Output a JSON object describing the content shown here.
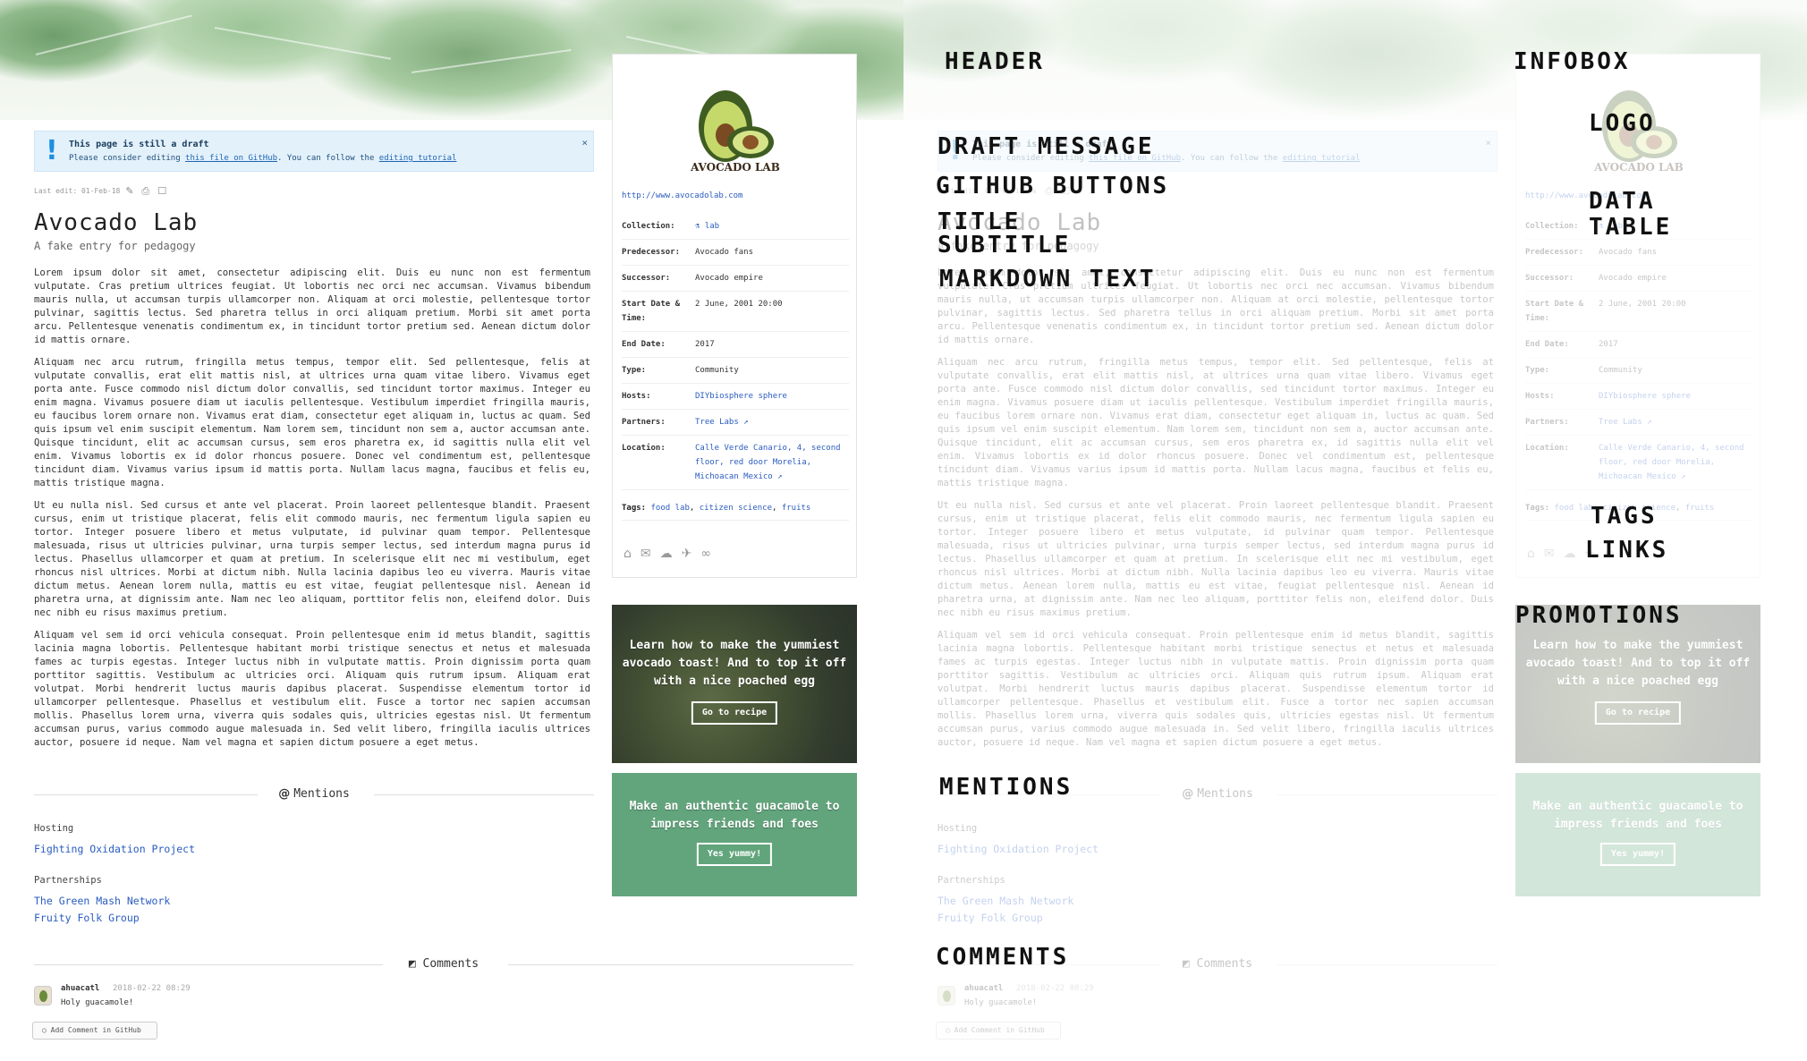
{
  "draft": {
    "title": "This page is still a draft",
    "msg_pre": "Please consider editing ",
    "msg_link1": "this file on GitHub",
    "msg_mid": ". You can follow the ",
    "msg_link2": "editing tutorial",
    "close": "×"
  },
  "lastedit": "Last edit: 01-Feb-18",
  "page": {
    "title": "Avocado Lab",
    "subtitle": "A fake entry for pedagogy"
  },
  "body_paragraphs": [
    "Lorem ipsum dolor sit amet, consectetur adipiscing elit. Duis eu nunc non est fermentum vulputate. Cras pretium ultrices feugiat. Ut lobortis nec orci nec accumsan. Vivamus bibendum mauris nulla, ut accumsan turpis ullamcorper non. Aliquam at orci molestie, pellentesque tortor pulvinar, sagittis lectus. Sed pharetra tellus in orci aliquam pretium. Morbi sit amet porta arcu. Pellentesque venenatis condimentum ex, in tincidunt tortor pretium sed. Aenean dictum dolor id mattis ornare.",
    "Aliquam nec arcu rutrum, fringilla metus tempus, tempor elit. Sed pellentesque, felis at vulputate convallis, erat elit mattis nisl, at ultrices urna quam vitae libero. Vivamus eget porta ante. Fusce commodo nisl dictum dolor convallis, sed tincidunt tortor maximus. Integer eu enim magna. Vivamus posuere diam ut iaculis pellentesque. Vestibulum imperdiet fringilla mauris, eu faucibus lorem ornare non. Vivamus erat diam, consectetur eget aliquam in, luctus ac quam. Sed quis ipsum vel enim suscipit elementum. Nam lorem sem, tincidunt non sem a, auctor accumsan ante. Quisque tincidunt, elit ac accumsan cursus, sem eros pharetra ex, id sagittis nulla elit vel enim. Vivamus lobortis ex id dolor rhoncus posuere. Donec vel condimentum est, pellentesque tincidunt diam. Vivamus varius ipsum id mattis porta. Nullam lacus magna, faucibus et felis eu, mattis tristique magna.",
    "Ut eu nulla nisl. Sed cursus et ante vel placerat. Proin laoreet pellentesque blandit. Praesent cursus, enim ut tristique placerat, felis elit commodo mauris, nec fermentum ligula sapien eu tortor. Integer posuere libero et metus vulputate, id pulvinar quam tempor. Pellentesque malesuada, risus ut ultricies pulvinar, urna turpis semper lectus, sed interdum magna purus id lectus. Phasellus ullamcorper et quam at pretium. In scelerisque elit nec mi vestibulum, eget rhoncus nisl ultrices. Morbi at dictum nibh. Nulla lacinia dapibus leo eu viverra. Mauris vitae dictum metus. Aenean lorem nulla, mattis eu est vitae, feugiat pellentesque nisl. Aenean id pharetra urna, at dignissim ante. Nam nec leo aliquam, porttitor felis non, eleifend dolor. Duis nec nibh eu risus maximus pretium.",
    "Aliquam vel sem id orci vehicula consequat. Proin pellentesque enim id metus blandit, sagittis lacinia magna lobortis. Pellentesque habitant morbi tristique senectus et netus et malesuada fames ac turpis egestas. Integer luctus nibh in vulputate mattis. Proin dignissim porta quam porttitor sagittis. Vestibulum ac ultricies orci. Aliquam quis rutrum ipsum. Aliquam erat volutpat. Morbi hendrerit luctus mauris dapibus placerat. Suspendisse elementum tortor id ullamcorper pellentesque. Phasellus et vestibulum elit. Fusce a tortor nec sapien accumsan mollis. Phasellus lorem urna, viverra quis sodales quis, ultricies egestas nisl. Ut fermentum accumsan purus, varius commodo augue malesuada in. Sed velit libero, fringilla iaculis ultrices auctor, posuere id neque. Nam vel magna et sapien dictum posuere a eget metus."
  ],
  "mentions": {
    "heading": "Mentions",
    "groups": [
      {
        "title": "Hosting",
        "links": [
          "Fighting Oxidation Project"
        ]
      },
      {
        "title": "Partnerships",
        "links": [
          "The Green Mash Network",
          "Fruity Folk Group"
        ]
      }
    ]
  },
  "comments": {
    "heading": "Comments",
    "author": "ahuacatl",
    "date": "2018-02-22 08:29",
    "text": "Holy guacamole!",
    "add_label": "Add Comment in GitHub"
  },
  "infobox": {
    "logo_text": "AVOCADO LAB",
    "website": "http://www.avocadolab.com",
    "rows": [
      {
        "k": "Collection:",
        "v": "lab"
      },
      {
        "k": "Predecessor:",
        "v": "Avocado fans"
      },
      {
        "k": "Successor:",
        "v": "Avocado empire"
      },
      {
        "k": "Start Date & Time:",
        "v": "2 June, 2001 20:00"
      },
      {
        "k": "End Date:",
        "v": "2017"
      },
      {
        "k": "Type:",
        "v": "Community"
      },
      {
        "k": "Hosts:",
        "v": "DIYbiosphere sphere"
      },
      {
        "k": "Partners:",
        "v": "Tree Labs ↗"
      },
      {
        "k": "Location:",
        "v": "Calle Verde Canario, 4, second floor, red door Morelia, Michoacan Mexico ↗"
      }
    ],
    "tags_label": "Tags:",
    "tags": [
      "food lab",
      "citizen science",
      "fruits"
    ]
  },
  "promotions": [
    {
      "text": "Learn how to make the yummiest avocado toast! And to top it off with a nice poached egg",
      "button": "Go to recipe"
    },
    {
      "text": "Make an authentic guacamole to impress friends and foes",
      "button": "Yes yummy!"
    }
  ],
  "annotations": {
    "header": "HEADER",
    "infobox": "INFOBOX",
    "logo": "LOGO",
    "draft": "DRAFT MESSAGE",
    "github": "GITHUB BUTTONS",
    "title": "TITLE",
    "subtitle": "SUBTITLE",
    "markdown": "MARKDOWN TEXT",
    "data_table_1": "DATA",
    "data_table_2": "TABLE",
    "tags": "TAGS",
    "links": "LINKS",
    "promotions": "PROMOTIONS",
    "mentions": "MENTIONS",
    "comments": "COMMENTS"
  },
  "colors": {
    "link": "#2a5cc0",
    "draft_bg": "#e3f1fb",
    "promo_green": "#62a57c"
  }
}
